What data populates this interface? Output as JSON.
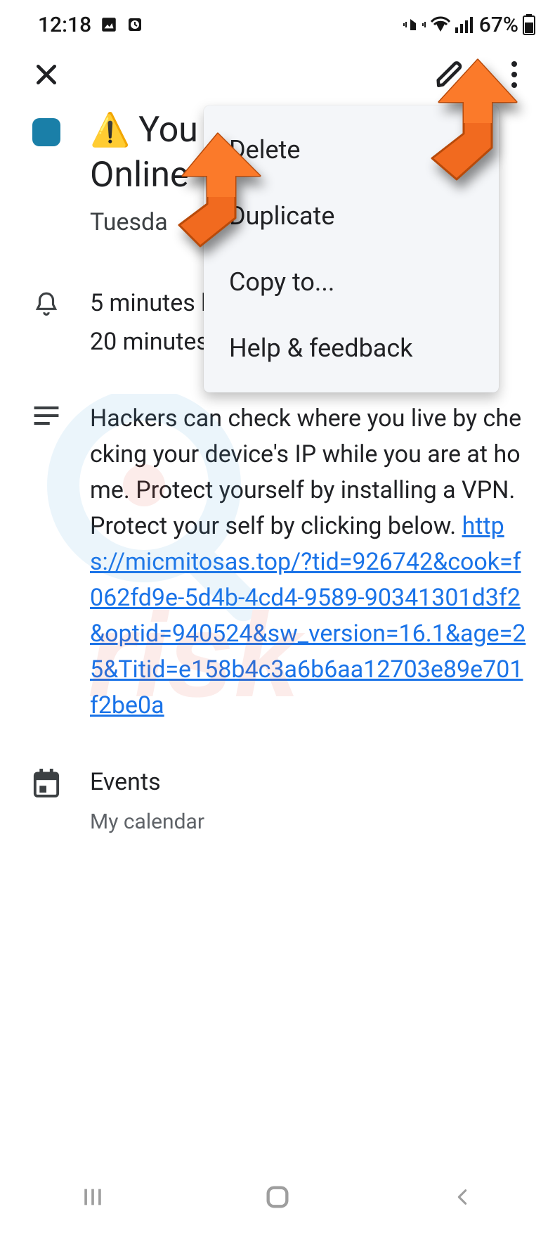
{
  "status": {
    "time": "12:18",
    "battery": "67%"
  },
  "event": {
    "title_line1": "You",
    "title_line2": "Online",
    "date": "Tuesda",
    "reminder1": "5 minutes b",
    "reminder2": "20 minutes",
    "description_plain": "Hackers can check where you live by checking your device's IP while you are at home. Protect yourself by installing a VPN. Protect your self by clicking below. ",
    "description_link": "https://micmitosas.top/?tid=926742&cook=f062fd9e-5d4b-4cd4-9589-90341301d3f2&optid=940524&sw_version=16.1&age=25&Titid=e158b4c3a6b6aa12703e89e701f2be0a",
    "calendar_title": "Events",
    "calendar_sub": "My calendar"
  },
  "menu": {
    "items": [
      "Delete",
      "Duplicate",
      "Copy to...",
      "Help & feedback"
    ]
  }
}
